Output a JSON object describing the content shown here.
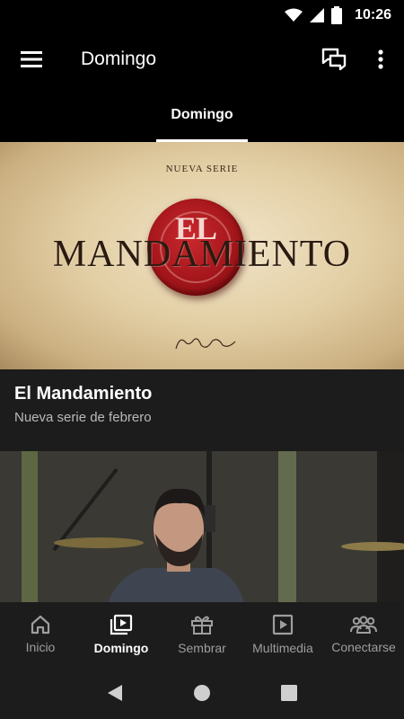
{
  "status_bar": {
    "time": "10:26"
  },
  "app_bar": {
    "title": "Domingo"
  },
  "tabs": [
    {
      "label": "Domingo"
    }
  ],
  "hero": {
    "kicker": "NUEVA SERIE",
    "title": "MANDAMIENTO",
    "seal_text": "EL"
  },
  "card": {
    "title": "El Mandamiento",
    "subtitle": "Nueva serie de febrero"
  },
  "bottom_nav": [
    {
      "label": "Inicio",
      "icon": "home-icon",
      "active": false
    },
    {
      "label": "Domingo",
      "icon": "video-library-icon",
      "active": true
    },
    {
      "label": "Sembrar",
      "icon": "gift-icon",
      "active": false
    },
    {
      "label": "Multimedia",
      "icon": "play-icon",
      "active": false
    },
    {
      "label": "Conectarse",
      "icon": "group-icon",
      "active": false
    }
  ],
  "colors": {
    "background": "#000000",
    "surface": "#1c1c1c",
    "seal": "#a4161b",
    "inactive": "#9e9e9e"
  }
}
